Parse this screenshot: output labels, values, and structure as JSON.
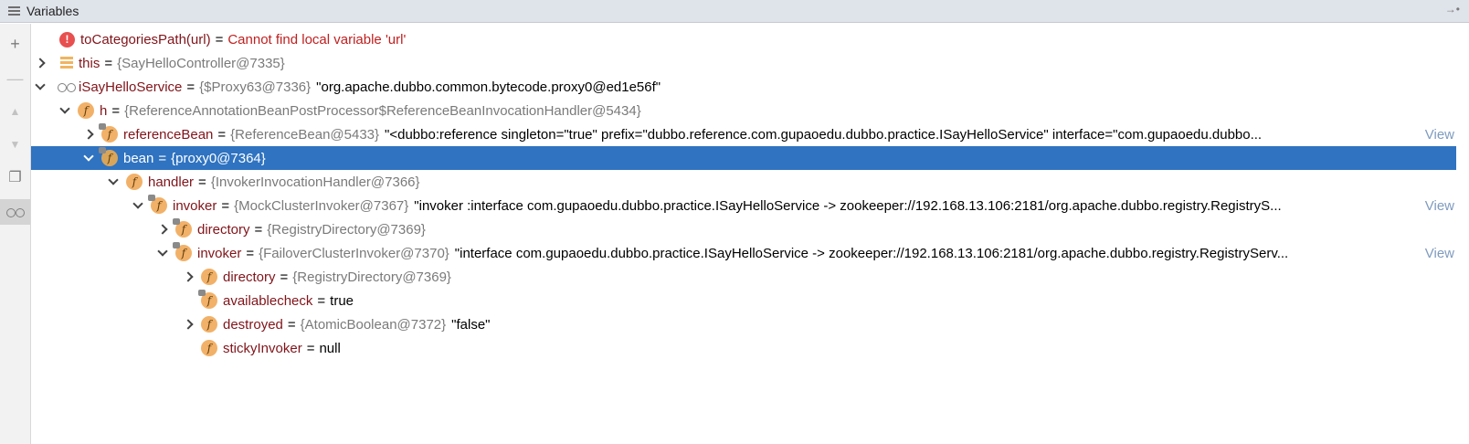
{
  "panel": {
    "title": "Variables"
  },
  "rows": [
    {
      "name": "toCategoriesPath(url)",
      "eq": "=",
      "message": "Cannot find local variable 'url'"
    },
    {
      "name": "this",
      "eq": "=",
      "type": "{SayHelloController@7335}"
    },
    {
      "name": "iSayHelloService",
      "eq": "=",
      "type": "{$Proxy63@7336}",
      "value": "\"org.apache.dubbo.common.bytecode.proxy0@ed1e56f\""
    },
    {
      "name": "h",
      "eq": "=",
      "type": "{ReferenceAnnotationBeanPostProcessor$ReferenceBeanInvocationHandler@5434}"
    },
    {
      "name": "referenceBean",
      "eq": "=",
      "type": "{ReferenceBean@5433}",
      "value": "\"<dubbo:reference singleton=\"true\" prefix=\"dubbo.reference.com.gupaoedu.dubbo.practice.ISayHelloService\" interface=\"com.gupaoedu.dubbo...",
      "link": "View"
    },
    {
      "name": "bean",
      "eq": "=",
      "type": "{proxy0@7364}"
    },
    {
      "name": "handler",
      "eq": "=",
      "type": "{InvokerInvocationHandler@7366}"
    },
    {
      "name": "invoker",
      "eq": "=",
      "type": "{MockClusterInvoker@7367}",
      "value": "\"invoker :interface com.gupaoedu.dubbo.practice.ISayHelloService -> zookeeper://192.168.13.106:2181/org.apache.dubbo.registry.RegistryS...",
      "link": "View"
    },
    {
      "name": "directory",
      "eq": "=",
      "type": "{RegistryDirectory@7369}"
    },
    {
      "name": "invoker",
      "eq": "=",
      "type": "{FailoverClusterInvoker@7370}",
      "value": "\"interface com.gupaoedu.dubbo.practice.ISayHelloService -> zookeeper://192.168.13.106:2181/org.apache.dubbo.registry.RegistryServ...",
      "link": "View"
    },
    {
      "name": "directory",
      "eq": "=",
      "type": "{RegistryDirectory@7369}"
    },
    {
      "name": "availablecheck",
      "eq": "=",
      "value": "true"
    },
    {
      "name": "destroyed",
      "eq": "=",
      "type": "{AtomicBoolean@7372}",
      "value": "\"false\""
    },
    {
      "name": "stickyInvoker",
      "eq": "=",
      "value": "null"
    }
  ],
  "icons": {
    "error": "!",
    "field": "f"
  },
  "colors": {
    "selection": "#2f73c1",
    "field_name": "#80141a",
    "error": "#c02020",
    "link": "#7f9bbf"
  }
}
